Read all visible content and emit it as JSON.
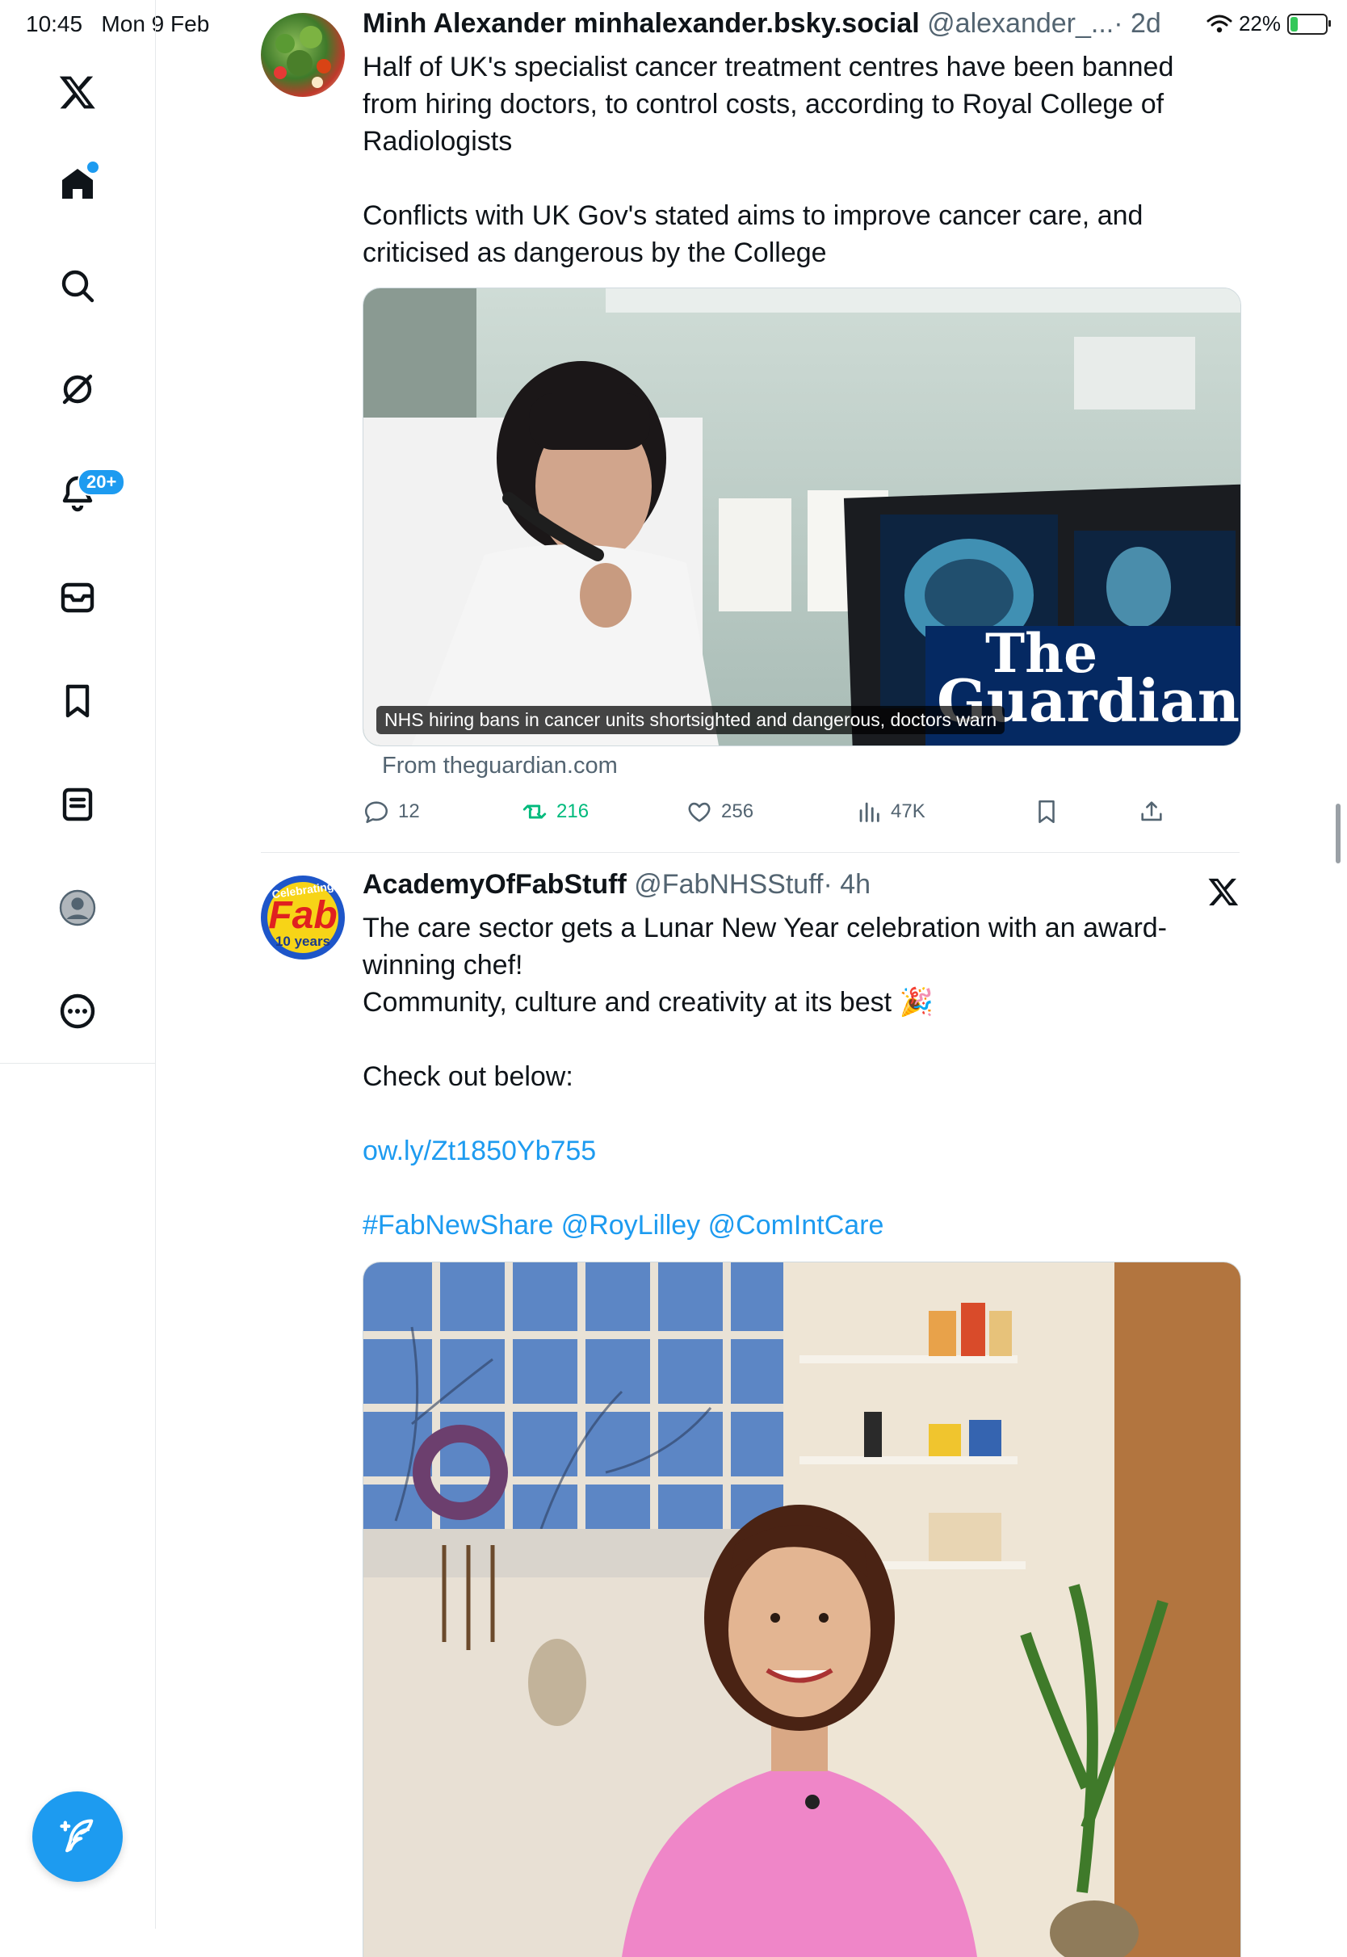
{
  "status_bar": {
    "time": "10:45",
    "date": "Mon 9 Feb",
    "battery_percent": "22%",
    "battery_level": 0.22
  },
  "sidebar": {
    "items": [
      {
        "icon": "x-logo-icon"
      },
      {
        "icon": "home-icon"
      },
      {
        "icon": "search-icon"
      },
      {
        "icon": "grok-icon"
      },
      {
        "icon": "notifications-bell-icon",
        "badge": "20+"
      },
      {
        "icon": "messages-icon"
      },
      {
        "icon": "bookmarks-icon"
      },
      {
        "icon": "lists-icon"
      },
      {
        "icon": "profile-icon"
      },
      {
        "icon": "more-icon"
      }
    ],
    "compose_icon": "compose-post-icon"
  },
  "tweets": [
    {
      "display_name": "Minh Alexander minhalexander.bsky.social",
      "handle": "@alexander_...",
      "time": "· 2d",
      "body": [
        "Half of UK's specialist cancer treatment centres have been banned from hiring doctors, to control costs, according to Royal College of Radiologists",
        "Conflicts with UK Gov's stated aims to improve cancer care, and criticised as dangerous by the College"
      ],
      "card": {
        "caption": "NHS hiring bans in cancer units shortsighted and dangerous, doctors warn",
        "logo_line1": "The",
        "logo_line2": "Guardian",
        "source": "From theguardian.com"
      },
      "actions": {
        "replies": "12",
        "reposts": "216",
        "likes": "256",
        "views": "47K"
      }
    },
    {
      "display_name": "AcademyOfFabStuff",
      "handle": "@FabNHSStuff",
      "time": "· 4h",
      "avatar_text_top": "Celebrating",
      "avatar_text_mid": "Fab",
      "avatar_text_bottom": "10 years",
      "body": {
        "line1": "The care sector gets a Lunar New Year celebration with an award-winning chef!",
        "line2": "Community, culture and creativity at its best 🎉",
        "line3": "Check out below:",
        "link": "ow.ly/Zt1850Yb755",
        "hashtag": "#FabNewShare",
        "mention1": "@RoyLilley",
        "mention2": "@ComIntCare"
      }
    }
  ],
  "colors": {
    "accent": "#1d9bf0",
    "repost_green": "#00ba7c",
    "muted": "#536471",
    "guardian_blue": "#052962"
  }
}
